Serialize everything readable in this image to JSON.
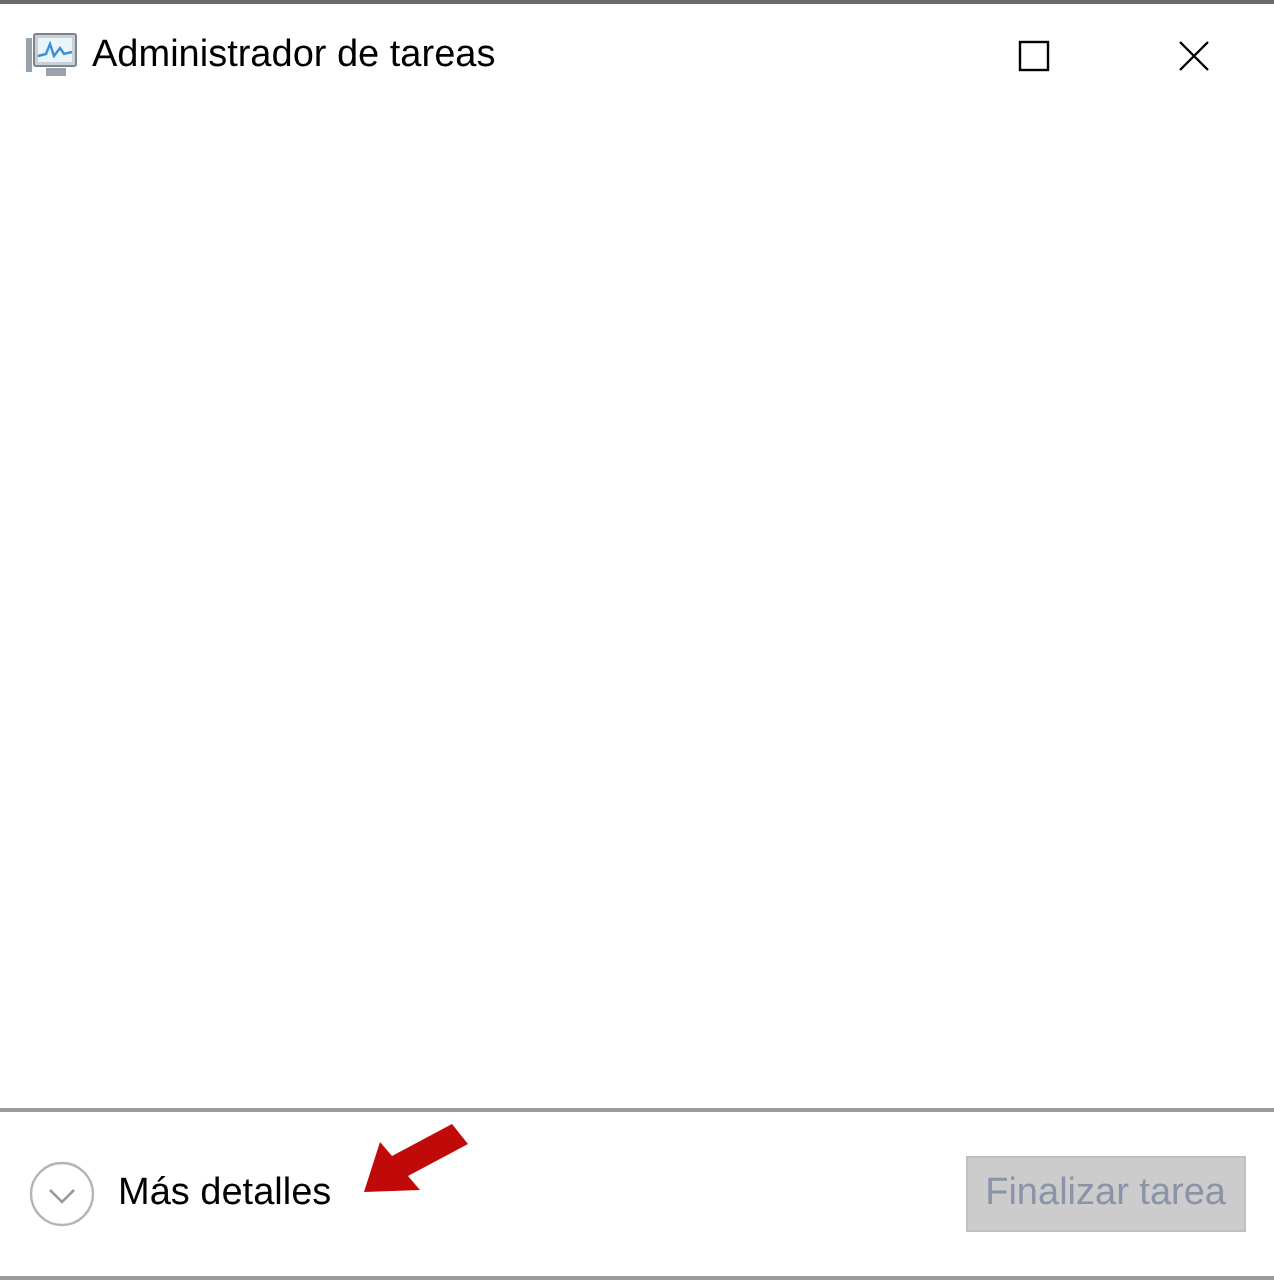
{
  "window": {
    "title": "Administrador de tareas"
  },
  "footer": {
    "details_link": "Más detalles",
    "end_task_button": {
      "label": "Finalizar tarea",
      "disabled": true
    },
    "annotation_arrow": true
  }
}
